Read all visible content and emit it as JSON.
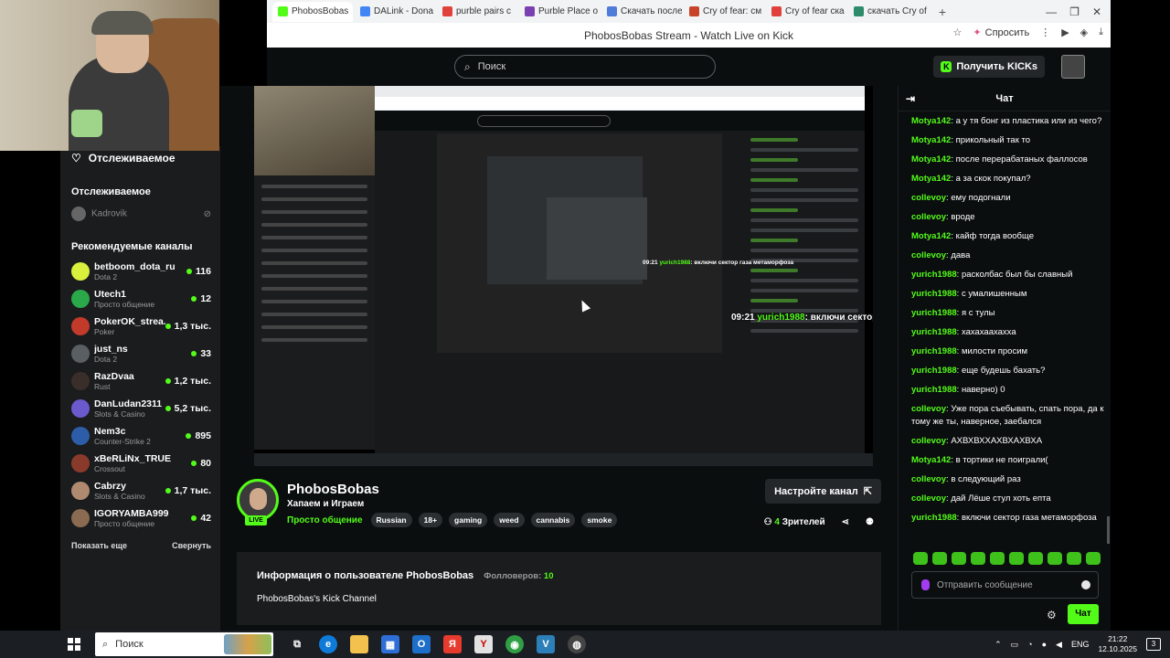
{
  "browser": {
    "tabs": [
      {
        "label": "PhobosBobas",
        "color": "#53fc18",
        "active": true
      },
      {
        "label": "DALink - Dona",
        "color": "#4285f4"
      },
      {
        "label": "purble pairs c",
        "color": "#e0413a"
      },
      {
        "label": "Purble Place o",
        "color": "#7a3fb0"
      },
      {
        "label": "Скачать после",
        "color": "#4f7cd8"
      },
      {
        "label": "Cry of fear: см",
        "color": "#c7432a"
      },
      {
        "label": "Cry of fear ска",
        "color": "#e0413a"
      },
      {
        "label": "скачать Cry of",
        "color": "#2d8c6a"
      }
    ],
    "new_tab": "+",
    "window_title": "PhobosBobas Stream - Watch Live on Kick",
    "ask_label": "Спросить",
    "minimize": "—",
    "maximize": "❐",
    "close": "✕"
  },
  "header": {
    "search_placeholder": "Поиск",
    "get_kicks_label": "Получить KICKs"
  },
  "sidebar": {
    "following_title": "Отслеживаемое",
    "following_section": "Отслеживаемое",
    "followed": [
      {
        "name": "Kadrovik"
      }
    ],
    "recommended_title": "Рекомендуемые каналы",
    "channels": [
      {
        "name": "betboom_dota_ru",
        "category": "Dota 2",
        "viewers": "116",
        "color": "#d9f03c"
      },
      {
        "name": "Utech1",
        "category": "Просто общение",
        "viewers": "12",
        "color": "#2aa84a"
      },
      {
        "name": "PokerOK_strea...",
        "category": "Poker",
        "viewers": "1,3 тыс.",
        "color": "#c23a2a"
      },
      {
        "name": "just_ns",
        "category": "Dota 2",
        "viewers": "33",
        "color": "#5a5f64"
      },
      {
        "name": "RazDvaa",
        "category": "Rust",
        "viewers": "1,2 тыс.",
        "color": "#3a2e2a"
      },
      {
        "name": "DanLudan2311",
        "category": "Slots & Casino",
        "viewers": "5,2 тыс.",
        "color": "#6a5acd"
      },
      {
        "name": "Nem3c",
        "category": "Counter-Strike 2",
        "viewers": "895",
        "color": "#2d5da8"
      },
      {
        "name": "xBeRLiNx_TRUE",
        "category": "Crossout",
        "viewers": "80",
        "color": "#8a3a2a"
      },
      {
        "name": "Cabrzy",
        "category": "Slots & Casino",
        "viewers": "1,7 тыс.",
        "color": "#b08a70"
      },
      {
        "name": "IGORYAMBA999",
        "category": "Просто общение",
        "viewers": "42",
        "color": "#8a6a50"
      }
    ],
    "show_more": "Показать еще",
    "collapse": "Свернуть"
  },
  "video": {
    "overlay_time": "09:21",
    "overlay_user": "yurich1988",
    "overlay_text": "включи сектор газа метаморфоза",
    "overlay2_time": "09:21",
    "overlay2_user": "yurich1988",
    "overlay2_text": "включи сектор газа метаморфоза"
  },
  "stream": {
    "streamer": "PhobosBobas",
    "live": "LIVE",
    "title": "Хапаем и Играем",
    "category": "Просто общение",
    "tags": [
      "Russian",
      "18+",
      "gaming",
      "weed",
      "cannabis",
      "smoke"
    ],
    "setup_label": "Настройте канал",
    "viewers": "4",
    "viewers_label": "Зрителей"
  },
  "about": {
    "title": "Информация о пользователе PhobosBobas",
    "followers_label": "Фолловеров:",
    "followers": "10",
    "description": "PhobosBobas's Kick Channel"
  },
  "chat": {
    "title": "Чат",
    "messages": [
      {
        "user": "Motya142",
        "text": "а у тя бонг из пластика или из чего?",
        "color": "#53fc18"
      },
      {
        "user": "Motya142",
        "text": "прикольный так то",
        "color": "#53fc18"
      },
      {
        "user": "Motya142",
        "text": "после перерабатаных фаллосов",
        "color": "#53fc18"
      },
      {
        "user": "Motya142",
        "text": "а за скок покупал?",
        "color": "#53fc18"
      },
      {
        "user": "collevoy",
        "text": "ему подогнали",
        "color": "#53fc18"
      },
      {
        "user": "collevoy",
        "text": "вроде",
        "color": "#53fc18"
      },
      {
        "user": "Motya142",
        "text": "кайф тогда вообще",
        "color": "#53fc18"
      },
      {
        "user": "collevoy",
        "text": "дава",
        "color": "#53fc18"
      },
      {
        "user": "yurich1988",
        "text": "расколбас был бы славный",
        "color": "#53fc18"
      },
      {
        "user": "yurich1988",
        "text": "с умалишенным",
        "color": "#53fc18"
      },
      {
        "user": "yurich1988",
        "text": "я с тулы",
        "color": "#53fc18"
      },
      {
        "user": "yurich1988",
        "text": "хахахаахахха",
        "color": "#53fc18"
      },
      {
        "user": "yurich1988",
        "text": "милости просим",
        "color": "#53fc18"
      },
      {
        "user": "yurich1988",
        "text": "еще будешь бахать?",
        "color": "#53fc18"
      },
      {
        "user": "yurich1988",
        "text": "наверно) 0",
        "color": "#53fc18"
      },
      {
        "user": "collevoy",
        "text": "Уже пора съебывать, спать пора, да к тому же ты, наверное, заебался",
        "color": "#53fc18"
      },
      {
        "user": "collevoy",
        "text": "АХВХВХХАХВХАХВХА",
        "color": "#53fc18"
      },
      {
        "user": "Motya142",
        "text": "в тортики не поиграли(",
        "color": "#53fc18"
      },
      {
        "user": "collevoy",
        "text": "в следующий раз",
        "color": "#53fc18"
      },
      {
        "user": "collevoy",
        "text": "дай Лёше стул хоть епта",
        "color": "#53fc18"
      },
      {
        "user": "yurich1988",
        "text": "включи сектор газа метаморфоза",
        "color": "#53fc18"
      }
    ],
    "input_placeholder": "Отправить сообщение",
    "send_label": "Чат"
  },
  "taskbar": {
    "search_placeholder": "Поиск",
    "language": "ENG",
    "time": "21:22",
    "date": "12.10.2025",
    "notifications": "3"
  }
}
